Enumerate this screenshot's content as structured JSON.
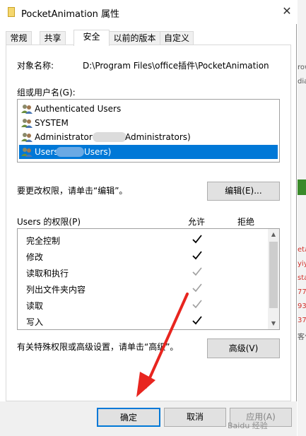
{
  "window": {
    "title": "PocketAnimation 属性",
    "close_glyph": "✕"
  },
  "tabs": [
    {
      "label": "常规",
      "active": false
    },
    {
      "label": "共享",
      "active": false
    },
    {
      "label": "安全",
      "active": true
    },
    {
      "label": "以前的版本",
      "active": false
    },
    {
      "label": "自定义",
      "active": false
    }
  ],
  "security": {
    "object_label": "对象名称:",
    "object_path": "D:\\Program Files\\office插件\\PocketAnimation",
    "group_label": "组或用户名(G):",
    "users": [
      {
        "name": "Authenticated Users",
        "icon": "users-icon",
        "selected": false
      },
      {
        "name": "SYSTEM",
        "icon": "users-icon",
        "selected": false
      },
      {
        "name": "Administrator",
        "suffix": "Administrators)",
        "icon": "users-icon",
        "selected": false
      },
      {
        "name": "Users",
        "suffix": "Users)",
        "icon": "users-icon",
        "selected": true
      }
    ],
    "edit_hint": "要更改权限，请单击“编辑”。",
    "edit_button": "编辑(E)...",
    "perm_label": "Users 的权限(P)",
    "allow_header": "允许",
    "deny_header": "拒绝",
    "permissions": [
      {
        "name": "完全控制",
        "allow": "explicit",
        "deny": false
      },
      {
        "name": "修改",
        "allow": "explicit",
        "deny": false
      },
      {
        "name": "读取和执行",
        "allow": "inherited",
        "deny": false
      },
      {
        "name": "列出文件夹内容",
        "allow": "inherited",
        "deny": false
      },
      {
        "name": "读取",
        "allow": "inherited",
        "deny": false
      },
      {
        "name": "写入",
        "allow": "explicit",
        "deny": false
      }
    ],
    "advanced_hint": "有关特殊权限或高级设置，请单击“高级”。",
    "advanced_button": "高级(V)"
  },
  "footer": {
    "ok": "确定",
    "cancel": "取消",
    "apply": "应用(A)"
  },
  "background_strip": [
    "row",
    "dia",
    "eta",
    "yiy",
    "sta",
    "77",
    "93",
    "37",
    "客化"
  ],
  "watermark": "Baidu 经验",
  "colors": {
    "selection": "#0078d7",
    "arrow": "#e8251f",
    "check_explicit": "#000000",
    "check_inherited": "#a0a0a0"
  }
}
